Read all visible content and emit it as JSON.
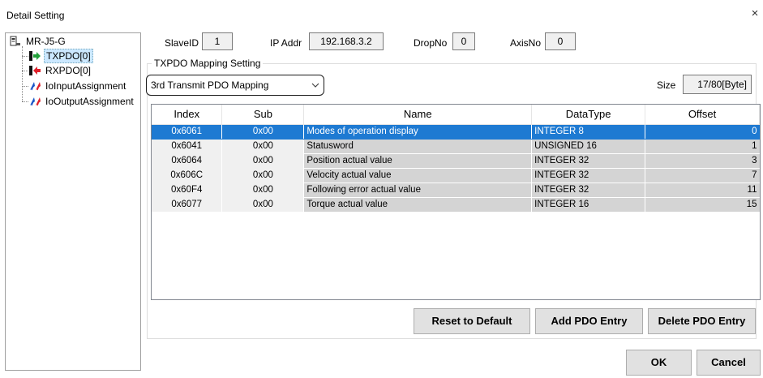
{
  "window": {
    "title": "Detail Setting",
    "close_glyph": "×"
  },
  "tree": {
    "root": {
      "label": "MR-J5-G",
      "icon": "device-icon"
    },
    "items": [
      {
        "label": "TXPDO[0]",
        "icon": "tx-arrow-icon",
        "selected": true
      },
      {
        "label": "RXPDO[0]",
        "icon": "rx-arrow-icon",
        "selected": false
      },
      {
        "label": "IoInputAssignment",
        "icon": "io-arrows-icon",
        "selected": false
      },
      {
        "label": "IoOutputAssignment",
        "icon": "io-arrows-icon",
        "selected": false
      }
    ]
  },
  "header": {
    "slave_id_label": "SlaveID",
    "slave_id": "1",
    "ip_label": "IP Addr",
    "ip": "192.168.3.2",
    "drop_label": "DropNo",
    "drop": "0",
    "axis_label": "AxisNo",
    "axis": "0"
  },
  "mapping": {
    "group_title": "TXPDO Mapping Setting",
    "selected_mapping": "3rd Transmit PDO Mapping",
    "size_label": "Size",
    "size_value": "17/80[Byte]"
  },
  "table": {
    "columns": [
      "Index",
      "Sub",
      "Name",
      "DataType",
      "Offset"
    ],
    "rows": [
      [
        "0x6061",
        "0x00",
        "Modes of operation display",
        "INTEGER 8",
        "0"
      ],
      [
        "0x6041",
        "0x00",
        "Statusword",
        "UNSIGNED 16",
        "1"
      ],
      [
        "0x6064",
        "0x00",
        "Position actual value",
        "INTEGER 32",
        "3"
      ],
      [
        "0x606C",
        "0x00",
        "Velocity actual value",
        "INTEGER 32",
        "7"
      ],
      [
        "0x60F4",
        "0x00",
        "Following error actual value",
        "INTEGER 32",
        "11"
      ],
      [
        "0x6077",
        "0x00",
        "Torque actual value",
        "INTEGER 16",
        "15"
      ]
    ],
    "selected_row": 0
  },
  "buttons": {
    "reset": "Reset to Default",
    "add": "Add PDO Entry",
    "delete": "Delete PDO Entry",
    "ok": "OK",
    "cancel": "Cancel"
  },
  "colors": {
    "selection": "#1e7ad2",
    "tx_arrow": "#22a03a",
    "rx_arrow": "#e0202a",
    "io_red": "#e0202a",
    "io_blue": "#1a55c8"
  }
}
